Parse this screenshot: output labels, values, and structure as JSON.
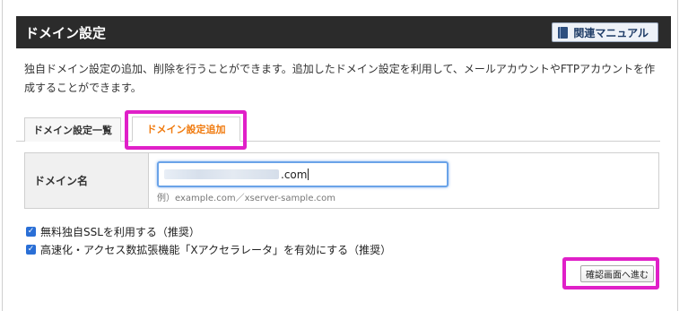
{
  "header": {
    "title": "ドメイン設定",
    "manual_label": "関連マニュアル"
  },
  "description": "独自ドメイン設定の追加、削除を行うことができます。追加したドメイン設定を利用して、メールアカウントやFTPアカウントを作成することができます。",
  "tabs": [
    {
      "label": "ドメイン設定一覧",
      "active": false
    },
    {
      "label": "ドメイン設定追加",
      "active": true
    }
  ],
  "form": {
    "domain_label": "ドメイン名",
    "domain_value_suffix": ".com",
    "domain_hint": "例）example.com／xserver-sample.com"
  },
  "options": [
    {
      "label": "無料独自SSLを利用する（推奨）",
      "checked": true
    },
    {
      "label": "高速化・アクセス数拡張機能「Xアクセラレータ」を有効にする（推奨）",
      "checked": true
    }
  ],
  "actions": {
    "confirm_label": "確認画面へ進む"
  },
  "colors": {
    "header_bg": "#2b2b2b",
    "active_tab_text": "#f07a0e",
    "highlight": "#e020c8",
    "checkbox": "#2a6fd6",
    "input_focus": "#6aa3e8"
  },
  "icons": {
    "manual": "book-icon",
    "checkbox": "checkmark-icon"
  }
}
